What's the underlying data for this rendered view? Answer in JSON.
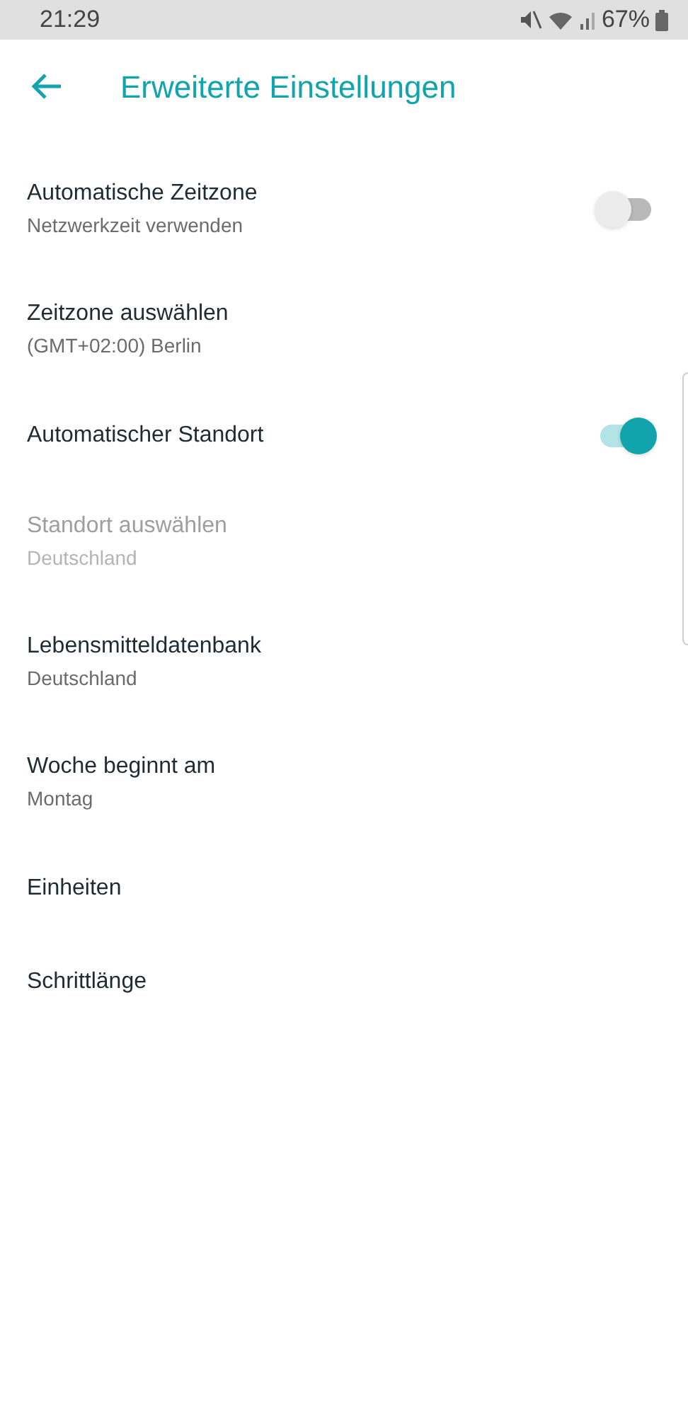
{
  "status_bar": {
    "time": "21:29",
    "battery": "67%"
  },
  "header": {
    "title": "Erweiterte Einstellungen"
  },
  "settings": [
    {
      "kind": "toggle",
      "title": "Automatische Zeitzone",
      "subtitle": "Netzwerkzeit verwenden",
      "on": false,
      "disabled": false
    },
    {
      "kind": "plain",
      "title": "Zeitzone auswählen",
      "subtitle": "(GMT+02:00) Berlin",
      "disabled": false
    },
    {
      "kind": "toggle",
      "title": "Automatischer Standort",
      "on": true,
      "disabled": false
    },
    {
      "kind": "plain",
      "title": "Standort auswählen",
      "subtitle": "Deutschland",
      "disabled": true
    },
    {
      "kind": "plain",
      "title": "Lebensmitteldatenbank",
      "subtitle": "Deutschland",
      "disabled": false
    },
    {
      "kind": "plain",
      "title": "Woche beginnt am",
      "subtitle": "Montag",
      "disabled": false
    },
    {
      "kind": "plain",
      "title": "Einheiten",
      "disabled": false
    },
    {
      "kind": "plain",
      "title": "Schrittlänge",
      "disabled": false
    }
  ]
}
